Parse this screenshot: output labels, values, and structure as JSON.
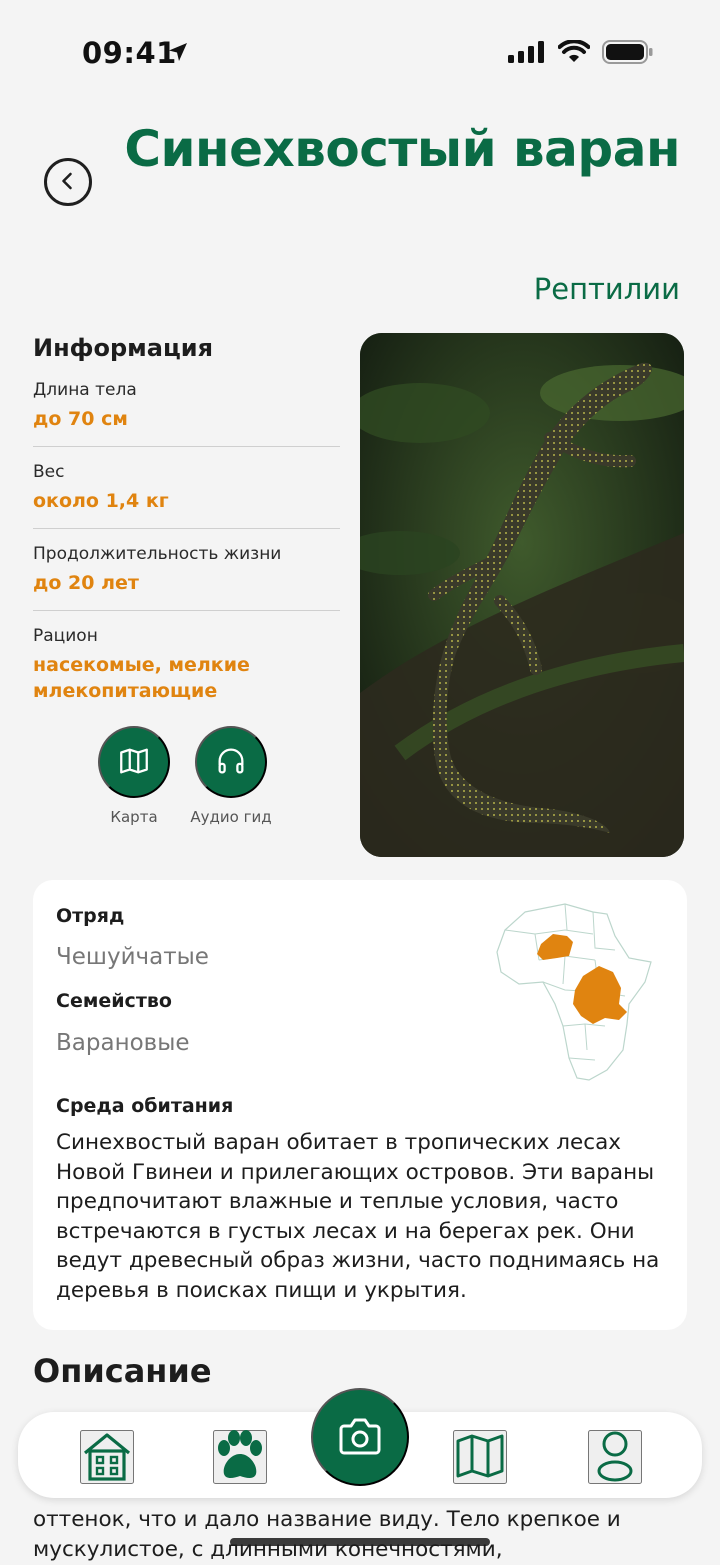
{
  "status": {
    "time": "09:41"
  },
  "header": {
    "title": "Синехвостый варан",
    "subtitle": "Рептилии"
  },
  "info": {
    "heading": "Информация",
    "items": [
      {
        "label": "Длина тела",
        "value": "до 70 см"
      },
      {
        "label": "Вес",
        "value": "около 1,4 кг"
      },
      {
        "label": "Продолжительность жизни",
        "value": "до 20 лет"
      },
      {
        "label": "Рацион",
        "value": "насекомые, мелкие млекопитающие"
      }
    ]
  },
  "actions": {
    "map_label": "Карта",
    "audio_label": "Аудио гид"
  },
  "classification": {
    "order_label": "Отряд",
    "order_value": "Чешуйчатые",
    "family_label": "Семейство",
    "family_value": "Варановые",
    "habitat_label": "Среда обитания",
    "habitat_text": "Синехвостый варан обитает в тропических лесах Новой Гвинеи и прилегающих островов. Эти вараны предпочитают влажные и теплые условия, часто встречаются в густых лесах и на берегах рек. Они ведут древесный образ жизни, часто поднимаясь на деревья в поисках пищи и укрытия."
  },
  "description": {
    "heading": "Описание",
    "text": "оттенок, что и дало название виду. Тело крепкое и мускулистое, с длинными конечностями,"
  },
  "colors": {
    "brand_green": "#0a6b45",
    "accent_orange": "#e08410"
  },
  "nav": {
    "items": [
      "home-icon",
      "paw-icon",
      "camera-icon",
      "map-icon",
      "profile-icon"
    ]
  }
}
